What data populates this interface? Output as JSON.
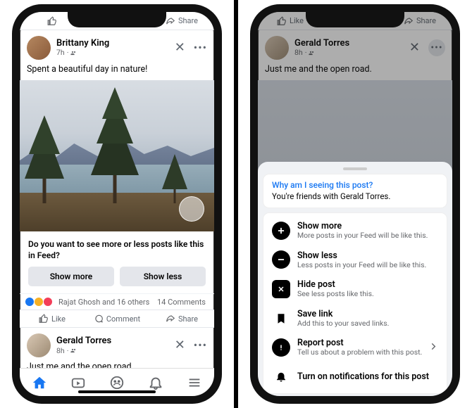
{
  "actions": {
    "like": "Like",
    "comment": "Comment",
    "share": "Share"
  },
  "left": {
    "post1": {
      "author": "Brittany King",
      "time": "7h",
      "audience": "friends",
      "text": "Spent a beautiful day in nature!",
      "prompt_question": "Do you want to see more or less posts like this in Feed?",
      "show_more": "Show more",
      "show_less": "Show less",
      "reaction_text": "Rajat Ghosh and 16 others",
      "comments": "14 Comments"
    },
    "post2": {
      "author": "Gerald Torres",
      "time": "8h",
      "audience": "friends",
      "text": "Just me and the open road."
    }
  },
  "right": {
    "post": {
      "author": "Gerald Torres",
      "time": "8h",
      "audience": "friends",
      "text": "Just me and the open road."
    },
    "sheet": {
      "info_q": "Why am I seeing this post?",
      "info_a": "You're friends with Gerald Torres.",
      "options": [
        {
          "icon": "plus",
          "title": "Show more",
          "sub": "More posts in your Feed will be like this."
        },
        {
          "icon": "minus",
          "title": "Show less",
          "sub": "Less posts in your Feed will be like this."
        },
        {
          "icon": "x",
          "title": "Hide post",
          "sub": "See less posts like this."
        },
        {
          "icon": "bookmark",
          "title": "Save link",
          "sub": "Add this to your saved links."
        },
        {
          "icon": "alert",
          "title": "Report post",
          "sub": "Tell us about a problem with this post.",
          "chevron": true
        },
        {
          "icon": "bell",
          "title": "Turn on notifications for this post",
          "sub": ""
        }
      ]
    }
  }
}
